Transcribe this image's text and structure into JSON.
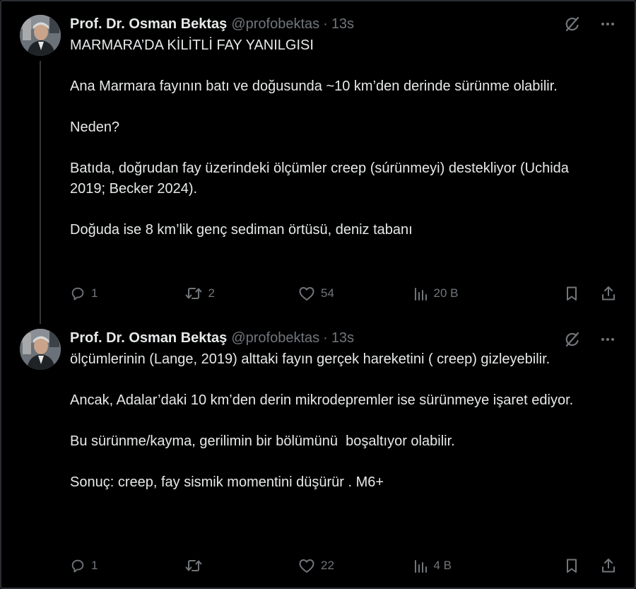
{
  "tweets": [
    {
      "author": {
        "name": "Prof. Dr. Osman Bektaş",
        "handle": "@profobektas",
        "time": "13s"
      },
      "text": "MARMARA’DA KİLİTLİ FAY YANILGISI\n\nAna Marmara fayının batı ve doğusunda ~10 km’den derinde sürünme olabilir.\n\nNeden?\n\nBatıda, doğrudan fay üzerindeki ölçümler creep (súrünmeyi) destekliyor (Uchida 2019; Becker 2024).\n\nDoğuda ise 8 km’lik genç sediman örtüsü, deniz tabanı",
      "stats": {
        "replies": "1",
        "reposts": "2",
        "likes": "54",
        "views": "20 B"
      }
    },
    {
      "author": {
        "name": "Prof. Dr. Osman Bektaş",
        "handle": "@profobektas",
        "time": "13s"
      },
      "text": "ölçümlerinin (Lange, 2019) alttaki fayın gerçek hareketini ( creep) gizleyebilir.\n\nAncak, Adalar’daki 10 km’den derin mikrodepremler ise sürünmeye işaret ediyor.\n\nBu sürünme/kayma, gerilimin bir bölümünü  boşaltıyor olabilir.\n\nSonuç: creep, fay sismik momentini düşürür . M6+",
      "stats": {
        "replies": "1",
        "reposts": "",
        "likes": "22",
        "views": "4 B"
      }
    }
  ],
  "separator": "·",
  "icons": {
    "grok": "grok-icon",
    "more": "more-icon",
    "reply": "reply-icon",
    "repost": "repost-icon",
    "like": "like-icon",
    "views": "views-icon",
    "bookmark": "bookmark-icon",
    "share": "share-icon"
  },
  "colors": {
    "background": "#000000",
    "text": "#e7e9ea",
    "muted": "#71767b",
    "thread_line": "#333639"
  }
}
